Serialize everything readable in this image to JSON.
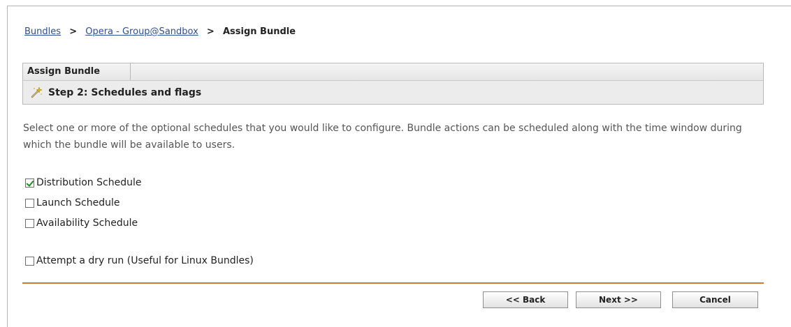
{
  "breadcrumb": {
    "items": [
      "Bundles",
      "Opera - Group@Sandbox"
    ],
    "separator": ">",
    "current": "Assign Bundle"
  },
  "panel": {
    "title": "Assign Bundle",
    "step": "Step 2: Schedules and flags",
    "step_icon": "wand-icon"
  },
  "description": "Select one or more of the optional schedules that you would like to configure. Bundle actions can be scheduled along with the time window during which the bundle will be available to users.",
  "options": [
    {
      "label": "Distribution Schedule",
      "checked": true
    },
    {
      "label": "Launch Schedule",
      "checked": false
    },
    {
      "label": "Availability Schedule",
      "checked": false
    }
  ],
  "dry_run": {
    "label": "Attempt a dry run (Useful for Linux Bundles)",
    "checked": false
  },
  "buttons": {
    "back": "<< Back",
    "next": "Next >>",
    "cancel": "Cancel"
  },
  "colors": {
    "divider": "#c97a35",
    "link": "#2f4f8f",
    "check": "#1e8a1e"
  }
}
